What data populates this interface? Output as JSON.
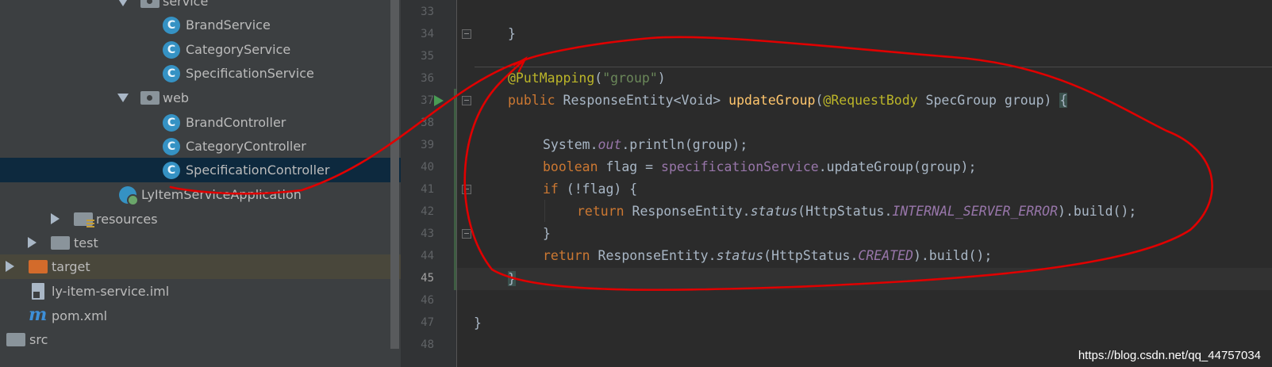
{
  "tree": {
    "items": [
      {
        "label": "service",
        "type": "package",
        "expanded": true,
        "icon": "package-icon"
      },
      {
        "label": "BrandService",
        "type": "class",
        "icon": "class-icon"
      },
      {
        "label": "CategoryService",
        "type": "class",
        "icon": "class-icon"
      },
      {
        "label": "SpecificationService",
        "type": "class",
        "icon": "class-icon"
      },
      {
        "label": "web",
        "type": "package",
        "expanded": true,
        "icon": "package-icon"
      },
      {
        "label": "BrandController",
        "type": "class",
        "icon": "class-icon"
      },
      {
        "label": "CategoryController",
        "type": "class",
        "icon": "class-icon"
      },
      {
        "label": "SpecificationController",
        "type": "class",
        "selected": true,
        "icon": "class-icon"
      },
      {
        "label": "LyItemServiceApplication",
        "type": "app",
        "icon": "spring-app-icon"
      },
      {
        "label": "resources",
        "type": "folder",
        "expanded": false,
        "icon": "resources-folder-icon"
      },
      {
        "label": "test",
        "type": "folder",
        "expanded": false,
        "icon": "folder-icon"
      },
      {
        "label": "target",
        "type": "folder",
        "expanded": false,
        "icon": "excluded-folder-icon"
      },
      {
        "label": "ly-item-service.iml",
        "type": "file",
        "icon": "iml-file-icon"
      },
      {
        "label": "pom.xml",
        "type": "file",
        "icon": "maven-icon"
      },
      {
        "label": "src",
        "type": "folder",
        "icon": "folder-icon"
      }
    ],
    "class_icon_letter": "C",
    "maven_icon_letter": "m"
  },
  "editor": {
    "line_numbers": [
      "33",
      "34",
      "35",
      "36",
      "37",
      "38",
      "39",
      "40",
      "41",
      "42",
      "43",
      "44",
      "45",
      "46",
      "47",
      "48"
    ],
    "current_line": "45",
    "lines": {
      "l34": {
        "brace": "}"
      },
      "l36": {
        "ann": "@PutMapping",
        "p1": "(",
        "str": "\"group\"",
        "p2": ")"
      },
      "l37": {
        "kw": "public ",
        "type": "ResponseEntity<Void> ",
        "fn": "updateGroup",
        "p1": "(",
        "ann": "@RequestBody",
        "rest": " SpecGroup group) ",
        "brace": "{"
      },
      "l39": {
        "a": "System.",
        "field": "out",
        "b": ".println(group);"
      },
      "l40": {
        "kw": "boolean",
        "a": " flag = ",
        "field": "specificationService",
        "b": ".updateGroup(group);"
      },
      "l41": {
        "kw": "if",
        "a": " (!flag) ",
        "brace": "{"
      },
      "l42": {
        "kw": "return",
        "a": " ResponseEntity.",
        "fn": "status",
        "b": "(HttpStatus.",
        "const": "INTERNAL_SERVER_ERROR",
        "c": ").build();"
      },
      "l43": {
        "brace": "}"
      },
      "l44": {
        "kw": "return",
        "a": " ResponseEntity.",
        "fn": "status",
        "b": "(HttpStatus.",
        "const": "CREATED",
        "c": ").build();"
      },
      "l45": {
        "brace": "}"
      },
      "l47": {
        "brace": "}"
      }
    }
  },
  "watermark": "https://blog.csdn.net/qq_44757034",
  "colors": {
    "tree_bg": "#3c3f41",
    "editor_bg": "#2b2b2b",
    "selection": "#0d293e",
    "annotation_stroke": "#e00000"
  }
}
